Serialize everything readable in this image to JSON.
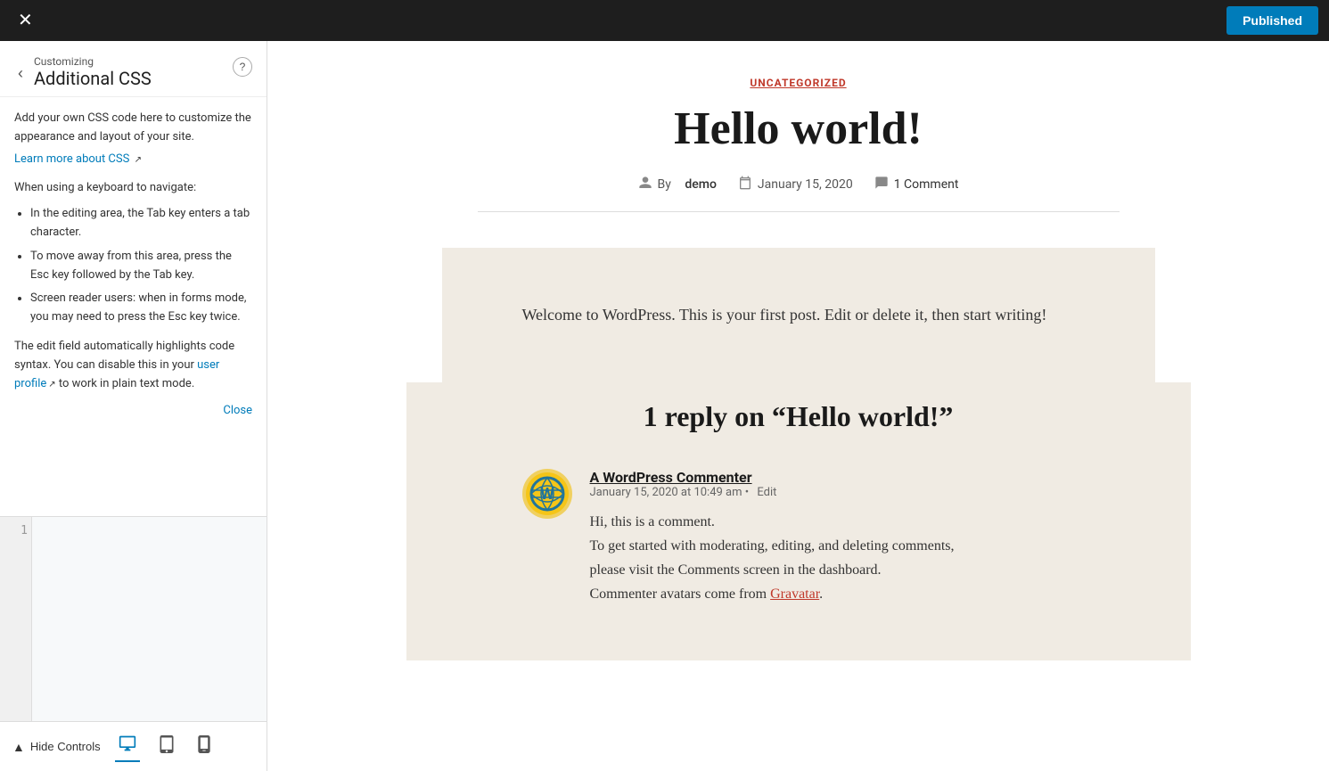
{
  "topbar": {
    "close_label": "✕",
    "published_label": "Published"
  },
  "sidebar": {
    "customizing_label": "Customizing",
    "title": "Additional CSS",
    "help_icon": "?",
    "back_icon": "‹",
    "description": "Add your own CSS code here to customize the appearance and layout of your site.",
    "learn_more_link": "Learn more about CSS",
    "keyboard_heading": "When using a keyboard to navigate:",
    "keyboard_items": [
      "In the editing area, the Tab key enters a tab character.",
      "To move away from this area, press the Esc key followed by the Tab key.",
      "Screen reader users: when in forms mode, you may need to press the Esc key twice."
    ],
    "auto_highlight_text": "The edit field automatically highlights code syntax. You can disable this in your ",
    "user_profile_link": "user profile",
    "plain_text_label": " to work in plain text mode.",
    "close_link": "Close",
    "line_number": "1",
    "code_placeholder": "",
    "hide_controls_label": "Hide Controls",
    "device_icons": [
      "desktop",
      "tablet",
      "mobile"
    ]
  },
  "post": {
    "category": "UNCATEGORIZED",
    "title": "Hello world!",
    "meta": {
      "author_prefix": "By",
      "author": "demo",
      "date": "January 15, 2020",
      "comments": "1 Comment"
    },
    "body": "Welcome to WordPress. This is your first post. Edit or delete it, then start writing!",
    "comments_section": {
      "title": "1 reply on “Hello world!”",
      "comment": {
        "author": "A WordPress Commenter",
        "date": "January 15, 2020 at 10:49 am",
        "edit_link": "Edit",
        "text_line1": "Hi, this is a comment.",
        "text_line2": "To get started with moderating, editing, and deleting comments,",
        "text_line3": "please visit the Comments screen in the dashboard.",
        "text_line4": "Commenter avatars come from ",
        "gravatar_link": "Gravatar",
        "text_end": "."
      }
    }
  }
}
